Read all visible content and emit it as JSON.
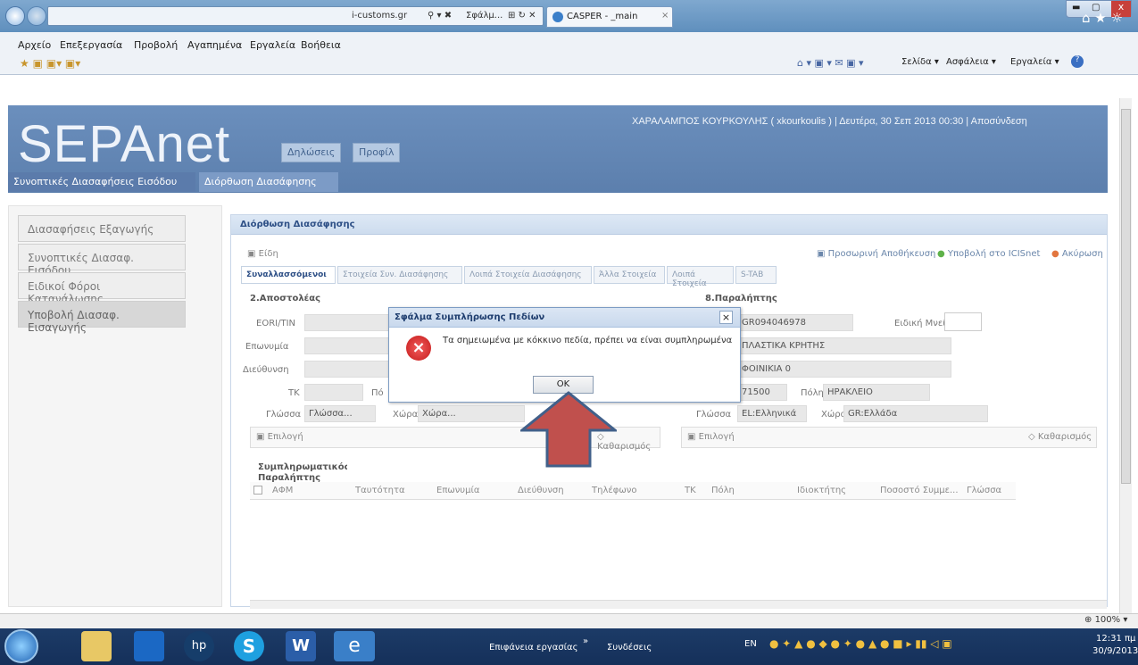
{
  "browser": {
    "tab1": "i-customs.gr",
    "tab2": "Σφάλμ...",
    "tab3": "CASPER - _main",
    "menu": [
      "Αρχείο",
      "Επεξεργασία",
      "Προβολή",
      "Αγαπημένα",
      "Εργαλεία",
      "Βοήθεια"
    ],
    "toolbar_right": [
      "Σελίδα ▾",
      "Ασφάλεια ▾",
      "Εργαλεία ▾"
    ],
    "zoom": "100%"
  },
  "app": {
    "logo": "SEPAnet",
    "tabs": [
      "Δηλώσεις",
      "Προφίλ"
    ],
    "user": "ΧΑΡΑΛΑΜΠΟΣ ΚΟΥΡΚΟΥΛΗΣ ( xkourkoulis ) | Δευτέρα, 30 Σεπ 2013 00:30 | Αποσύνδεση",
    "breadcrumbs": [
      "Συνοπτικές Διασαφήσεις Εισόδου",
      "Διόρθωση Διασάφησης"
    ]
  },
  "sidebar": [
    "Διασαφήσεις Εξαγωγής",
    "Συνοπτικές Διασαφ. Εισόδου",
    "Ειδικοί Φόροι Κατανάλωσης",
    "Υποβολή Διασαφ. Εισαγωγής"
  ],
  "panel": {
    "title": "Διόρθωση Διασάφησης",
    "items_btn": "Είδη",
    "actions": [
      "Προσωρινή Αποθήκευση",
      "Υποβολή στο ICISnet",
      "Ακύρωση"
    ],
    "tabs": [
      "Συναλλασσόμενοι",
      "Στοιχεία Συν. Διασάφησης",
      "Λοιπά Στοιχεία Διασάφησης",
      "Άλλα Στοιχεία",
      "Λοιπά Στοιχεία",
      "S-TAB"
    ],
    "sender_title": "2.Αποστολέας",
    "receiver_title": "8.Παραλήπτης",
    "labels": {
      "eori": "EORI/TIN",
      "name": "Επωνυμία",
      "addr": "Διεύθυνση",
      "tk": "ΤΚ",
      "city": "Πόλη",
      "city_short": "Πό",
      "lang": "Γλώσσα",
      "country": "Χώρα",
      "special": "Ειδική Μνεία"
    },
    "sender": {
      "lang": "Γλώσσα...",
      "country": "Χώρα..."
    },
    "receiver": {
      "eori": "GR094046978",
      "name": "ΠΛΑΣΤΙΚΑ ΚΡΗΤΗΣ",
      "addr": "ΦΟΙΝΙΚΙΑ 0",
      "tk": "71500",
      "city": "ΗΡΑΚΛΕΙΟ",
      "lang": "EL:Ελληνικά",
      "country": "GR:Ελλάδα"
    },
    "select_btn": "Επιλογή",
    "clear_btn": "Καθαρισμός",
    "supp_title": "Συμπληρωματικός Παραλήπτης",
    "columns": [
      "ΑΦΜ",
      "Ταυτότητα",
      "Επωνυμία",
      "Διεύθυνση",
      "Τηλέφωνο",
      "ΤΚ",
      "Πόλη",
      "Ιδιοκτήτης",
      "Ποσοστό Συμμε...",
      "Γλώσσα"
    ]
  },
  "dialog": {
    "title": "Σφάλμα Συμπλήρωσης Πεδίων",
    "message": "Τα σημειωμένα με κόκκινο πεδία, πρέπει να είναι συμπληρωμένα",
    "ok": "OK",
    "close": "×"
  },
  "taskbar": {
    "desktop": "Επιφάνεια εργασίας",
    "links": "Συνδέσεις",
    "lang": "EN",
    "time": "12:31 πμ",
    "date": "30/9/2013"
  },
  "colors": {
    "header": "#6b8fbd",
    "arrow": "#c0504d",
    "arrow_border": "#41608a",
    "error": "#d9262b"
  }
}
